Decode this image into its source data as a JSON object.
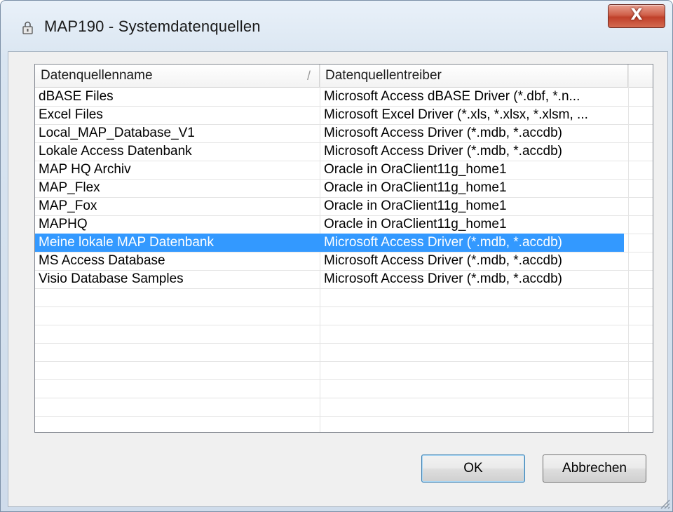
{
  "window": {
    "title": "MAP190 - Systemdatenquellen",
    "close_label": "X"
  },
  "list": {
    "columns": [
      {
        "label": "Datenquellenname",
        "sort_indicator": "/"
      },
      {
        "label": "Datenquellentreiber"
      }
    ],
    "rows": [
      {
        "name": "dBASE Files",
        "driver": "Microsoft Access dBASE Driver (*.dbf, *.n..."
      },
      {
        "name": "Excel Files",
        "driver": "Microsoft Excel Driver (*.xls, *.xlsx, *.xlsm, ..."
      },
      {
        "name": "Local_MAP_Database_V1",
        "driver": "Microsoft Access Driver (*.mdb, *.accdb)"
      },
      {
        "name": "Lokale Access Datenbank",
        "driver": "Microsoft Access Driver (*.mdb, *.accdb)"
      },
      {
        "name": "MAP HQ Archiv",
        "driver": "Oracle in OraClient11g_home1"
      },
      {
        "name": "MAP_Flex",
        "driver": "Oracle in OraClient11g_home1"
      },
      {
        "name": "MAP_Fox",
        "driver": "Oracle in OraClient11g_home1"
      },
      {
        "name": "MAPHQ",
        "driver": "Oracle in OraClient11g_home1"
      },
      {
        "name": "Meine lokale MAP Datenbank",
        "driver": "Microsoft Access Driver (*.mdb, *.accdb)",
        "selected": true
      },
      {
        "name": "MS Access Database",
        "driver": "Microsoft Access Driver (*.mdb, *.accdb)"
      },
      {
        "name": "Visio Database Samples",
        "driver": "Microsoft Access Driver (*.mdb, *.accdb)"
      }
    ]
  },
  "buttons": {
    "ok": "OK",
    "cancel": "Abbrechen"
  },
  "colors": {
    "selection": "#3399ff",
    "close": "#c0402a"
  },
  "icons": {
    "title": "lock-icon",
    "close": "close-icon",
    "resize": "resize-grip-icon"
  }
}
